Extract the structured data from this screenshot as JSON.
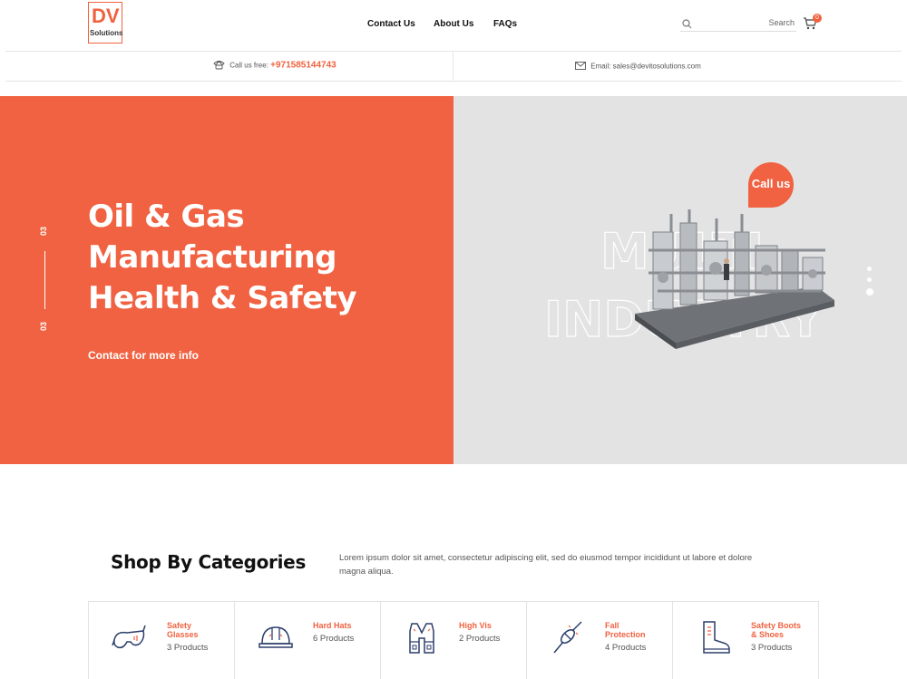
{
  "header": {
    "logo_main": "DV",
    "logo_sub": "Solutions",
    "nav": [
      {
        "label": "Contact Us"
      },
      {
        "label": "About Us"
      },
      {
        "label": "FAQs"
      }
    ],
    "search_placeholder": "Search",
    "cart_count": "0"
  },
  "contact_bar": {
    "phone_label": "Call us free:",
    "phone_number": "+971585144743",
    "email_label": "Email: sales@devitosolutions.com"
  },
  "hero": {
    "title_lines": [
      "Oil & Gas",
      "Manufacturing",
      "Health & Safety"
    ],
    "cta": "Contact for more info",
    "slide_current": "03",
    "slide_total": "03",
    "bg_text_1": "MULTI",
    "bg_text_2": "INDUSTRY",
    "call_button": "Call us"
  },
  "shop": {
    "title": "Shop By Categories",
    "description": "Lorem ipsum dolor sit amet, consectetur adipiscing elit, sed do eiusmod tempor incididunt ut labore et dolore magna aliqua.",
    "categories": [
      {
        "name_1": "Safety",
        "name_2": "Glasses",
        "count": "3 Products",
        "icon": "safety-glasses-icon"
      },
      {
        "name_1": "Hard Hats",
        "name_2": "",
        "count": "6 Products",
        "icon": "hard-hat-icon"
      },
      {
        "name_1": "High Vis",
        "name_2": "",
        "count": "2 Products",
        "icon": "high-vis-vest-icon"
      },
      {
        "name_1": "Fall",
        "name_2": "Protection",
        "count": "4 Products",
        "icon": "fall-protection-icon"
      },
      {
        "name_1": "Safety Boots",
        "name_2": "& Shoes",
        "count": "3 Products",
        "icon": "safety-boot-icon"
      }
    ]
  },
  "colors": {
    "accent": "#f06241",
    "hero_right_bg": "#e3e3e3"
  }
}
